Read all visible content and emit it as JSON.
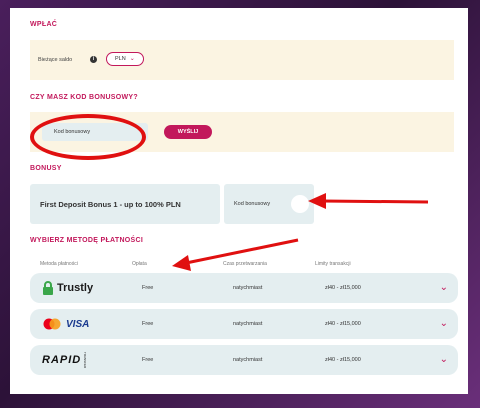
{
  "deposit": {
    "title": "WPŁAĆ",
    "balance_label": "Bieżące saldo",
    "currency": "PLN"
  },
  "bonus_code_section": {
    "title": "CZY MASZ KOD BONUSOWY?",
    "input_label": "Kod bonusowy",
    "send_label": "WYŚLIJ"
  },
  "bonuses": {
    "title": "BONUSY",
    "card_text": "First Deposit Bonus 1 - up to 100% PLN",
    "code_label": "Kod bonusowy"
  },
  "payment": {
    "title": "WYBIERZ METODĘ PŁATNOŚCI",
    "headers": {
      "method": "Metoda płatności",
      "fee": "Opłata",
      "time": "Czas przetwarzania",
      "limits": "Limity transakcji"
    },
    "methods": [
      {
        "name": "Trustly",
        "fee": "Free",
        "time": "natychmiast",
        "limit": "zł40 - zł15,000"
      },
      {
        "name": "VISA",
        "fee": "Free",
        "time": "natychmiast",
        "limit": "zł40 - zł15,000"
      },
      {
        "name": "RAPID",
        "sub": "TRANSFER",
        "fee": "Free",
        "time": "natychmiast",
        "limit": "zł40 - zł15,000"
      }
    ]
  },
  "colors": {
    "accent": "#c2185b",
    "annotation_red": "#e01010",
    "cream": "#fbf4e2",
    "row_bg": "#e4eef0"
  },
  "icons": [
    "info-icon",
    "chevron-down-icon",
    "trustly-logo",
    "mastercard-logo",
    "visa-logo",
    "rapid-transfer-logo"
  ]
}
